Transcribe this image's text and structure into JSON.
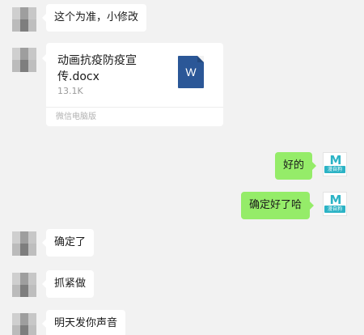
{
  "messages": [
    {
      "text": "这个为准，小修改"
    },
    {
      "text": "好的"
    },
    {
      "text": "确定好了哈"
    },
    {
      "text": "确定了"
    },
    {
      "text": "抓紧做"
    },
    {
      "text": "明天发你声音"
    }
  ],
  "file": {
    "name": "动画抗疫防疫宣传.docx",
    "size": "13.1K",
    "source": "微信电脑版",
    "icon_letter": "W",
    "icon": "word-document-icon"
  },
  "brand_avatar": {
    "letter": "M",
    "caption": "漫自狗",
    "color": "#2bb3c5"
  },
  "colors": {
    "background": "#f2f2f2",
    "incoming_bubble": "#ffffff",
    "outgoing_bubble": "#95ec69",
    "word_blue": "#2b5797"
  }
}
